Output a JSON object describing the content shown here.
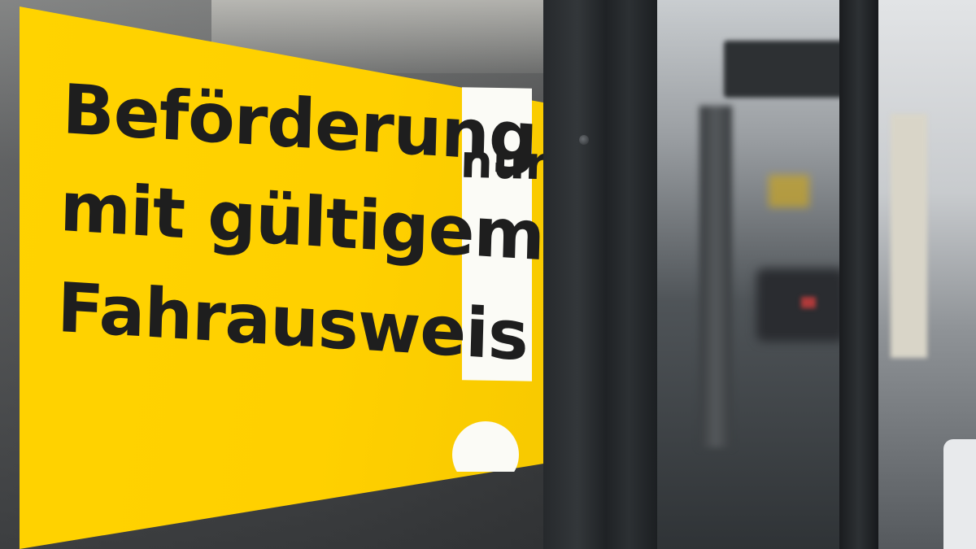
{
  "sign": {
    "line1": "Beförderung",
    "line1_suffix": "nur",
    "line2": "mit gültigem",
    "line3": "Fahrausweis",
    "color": "#ffd300",
    "text_color": "#1e1e1e",
    "exclamation_color": "#fbfbf6"
  }
}
